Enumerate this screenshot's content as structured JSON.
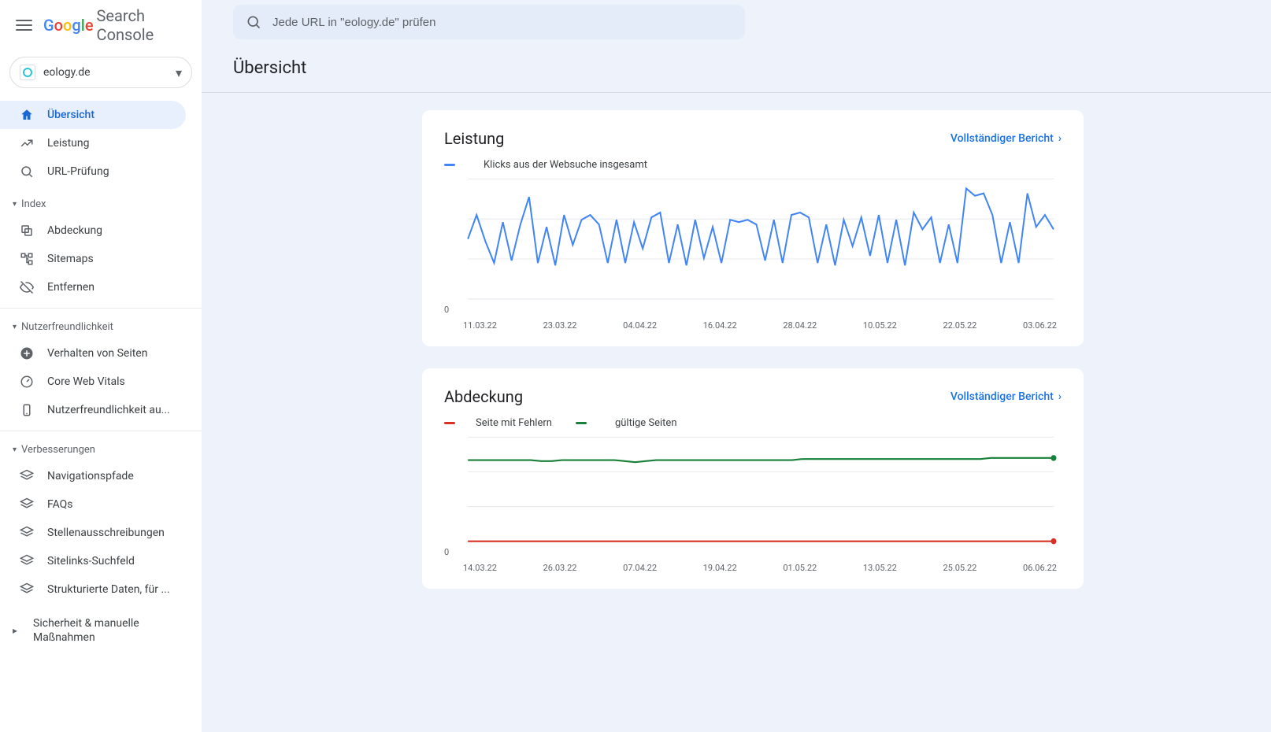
{
  "app": {
    "logo_text": "Search Console",
    "search_placeholder": "Jede URL in \"eology.de\" prüfen",
    "property": "eology.de"
  },
  "page": {
    "title": "Übersicht"
  },
  "nav": {
    "top": [
      {
        "id": "overview",
        "label": "Übersicht",
        "icon": "home",
        "active": true
      },
      {
        "id": "performance",
        "label": "Leistung",
        "icon": "trend"
      },
      {
        "id": "url-inspect",
        "label": "URL-Prüfung",
        "icon": "search"
      }
    ],
    "sections": [
      {
        "title": "Index",
        "items": [
          {
            "id": "coverage",
            "label": "Abdeckung",
            "icon": "copy"
          },
          {
            "id": "sitemaps",
            "label": "Sitemaps",
            "icon": "tree"
          },
          {
            "id": "remove",
            "label": "Entfernen",
            "icon": "eye-off"
          }
        ]
      },
      {
        "title": "Nutzerfreundlichkeit",
        "items": [
          {
            "id": "page-behavior",
            "label": "Verhalten von Seiten",
            "icon": "plus-circle"
          },
          {
            "id": "cwv",
            "label": "Core Web Vitals",
            "icon": "gauge"
          },
          {
            "id": "mobile",
            "label": "Nutzerfreundlichkeit au...",
            "icon": "phone"
          }
        ]
      },
      {
        "title": "Verbesserungen",
        "items": [
          {
            "id": "breadcrumbs",
            "label": "Navigationspfade",
            "icon": "layers"
          },
          {
            "id": "faq",
            "label": "FAQs",
            "icon": "layers"
          },
          {
            "id": "jobs",
            "label": "Stellenausschreibungen",
            "icon": "layers"
          },
          {
            "id": "sitelinks",
            "label": "Sitelinks-Suchfeld",
            "icon": "layers"
          },
          {
            "id": "structured",
            "label": "Strukturierte Daten, für ...",
            "icon": "layers"
          }
        ]
      }
    ],
    "security": {
      "label": "Sicherheit & manuelle Maßnahmen"
    }
  },
  "cards": {
    "performance": {
      "title": "Leistung",
      "full_report": "Vollständiger Bericht",
      "legend": "Klicks aus der Websuche insgesamt",
      "y_zero": "0"
    },
    "coverage": {
      "title": "Abdeckung",
      "full_report": "Vollständiger Bericht",
      "legend_error": "Seite mit Fehlern",
      "legend_valid": "gültige Seiten",
      "y_zero": "0"
    }
  },
  "colors": {
    "blue": "#4285f4",
    "link": "#1a73e8",
    "green": "#188038",
    "red": "#d93025",
    "grid": "#e8eaed"
  },
  "chart_data": [
    {
      "type": "line",
      "title": "Leistung",
      "legend": [
        "Klicks aus der Websuche insgesamt"
      ],
      "x_ticks": [
        "11.03.22",
        "23.03.22",
        "04.04.22",
        "16.04.22",
        "28.04.22",
        "10.05.22",
        "22.05.22",
        "03.06.22"
      ],
      "ylim": [
        0,
        100
      ],
      "ylabel": "",
      "xlabel": "",
      "series": [
        {
          "name": "Klicks aus der Websuche insgesamt",
          "color": "#4285f4",
          "values": [
            50,
            70,
            48,
            30,
            64,
            32,
            62,
            85,
            30,
            60,
            28,
            70,
            45,
            66,
            70,
            62,
            30,
            66,
            30,
            64,
            42,
            68,
            72,
            30,
            62,
            28,
            66,
            34,
            60,
            30,
            66,
            64,
            66,
            62,
            32,
            66,
            30,
            70,
            72,
            68,
            30,
            62,
            28,
            66,
            44,
            68,
            36,
            70,
            30,
            66,
            28,
            72,
            58,
            68,
            30,
            62,
            30,
            92,
            86,
            88,
            70,
            30,
            64,
            30,
            88,
            60,
            70,
            58
          ]
        }
      ]
    },
    {
      "type": "line",
      "title": "Abdeckung",
      "legend": [
        "Seite mit Fehlern",
        "gültige Seiten"
      ],
      "x_ticks": [
        "14.03.22",
        "26.03.22",
        "07.04.22",
        "19.04.22",
        "01.05.22",
        "13.05.22",
        "25.05.22",
        "06.06.22"
      ],
      "ylim": [
        0,
        100
      ],
      "ylabel": "",
      "xlabel": "",
      "series": [
        {
          "name": "Seite mit Fehlern",
          "color": "#d93025",
          "values": [
            0,
            0,
            0,
            0,
            0,
            0,
            0,
            0,
            0,
            0,
            0,
            0,
            0,
            0,
            0,
            0,
            0,
            0,
            0,
            0,
            0,
            0,
            0,
            0,
            0,
            0,
            0,
            0,
            0,
            0,
            0,
            0,
            0,
            0,
            0,
            0,
            0,
            0,
            0,
            0,
            0,
            0,
            0,
            0,
            0,
            0,
            0,
            0,
            0,
            0,
            0,
            0,
            0,
            0,
            0,
            0,
            0
          ]
        },
        {
          "name": "gültige Seiten",
          "color": "#188038",
          "values": [
            78,
            78,
            78,
            78,
            78,
            78,
            78,
            77,
            77,
            78,
            78,
            78,
            78,
            78,
            78,
            77,
            76,
            77,
            78,
            78,
            78,
            78,
            78,
            78,
            78,
            78,
            78,
            78,
            78,
            78,
            78,
            78,
            79,
            79,
            79,
            79,
            79,
            79,
            79,
            79,
            79,
            79,
            79,
            79,
            79,
            79,
            79,
            79,
            79,
            79,
            80,
            80,
            80,
            80,
            80,
            80,
            80
          ]
        }
      ]
    }
  ]
}
